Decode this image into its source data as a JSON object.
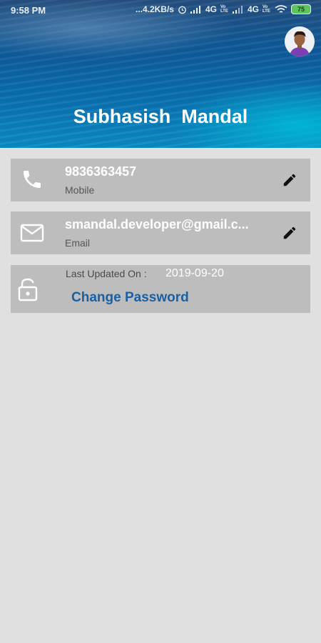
{
  "status_bar": {
    "time": "9:58 PM",
    "network_speed": "...4.2KB/s",
    "network_label_1": "4G",
    "network_label_2": "4G",
    "volte_label_1": "Vo LTE",
    "volte_label_2": "Vo LTE",
    "battery": "75"
  },
  "profile": {
    "name": "Subhasish  Mandal"
  },
  "phone": {
    "value": "9836363457",
    "label": "Mobile"
  },
  "email": {
    "value": "smandal.developer@gmail.c...",
    "label": "Email"
  },
  "password": {
    "last_updated_label": "Last Updated On :",
    "last_updated_date": "2019-09-20",
    "change_label": "Change Password"
  },
  "icons": {
    "phone": "phone-icon",
    "email": "mail-icon",
    "lock": "lock-icon",
    "edit": "pencil-icon"
  },
  "colors": {
    "background": "#e0e0e0",
    "card": "#bdbdbd",
    "link": "#1a5fa3"
  }
}
